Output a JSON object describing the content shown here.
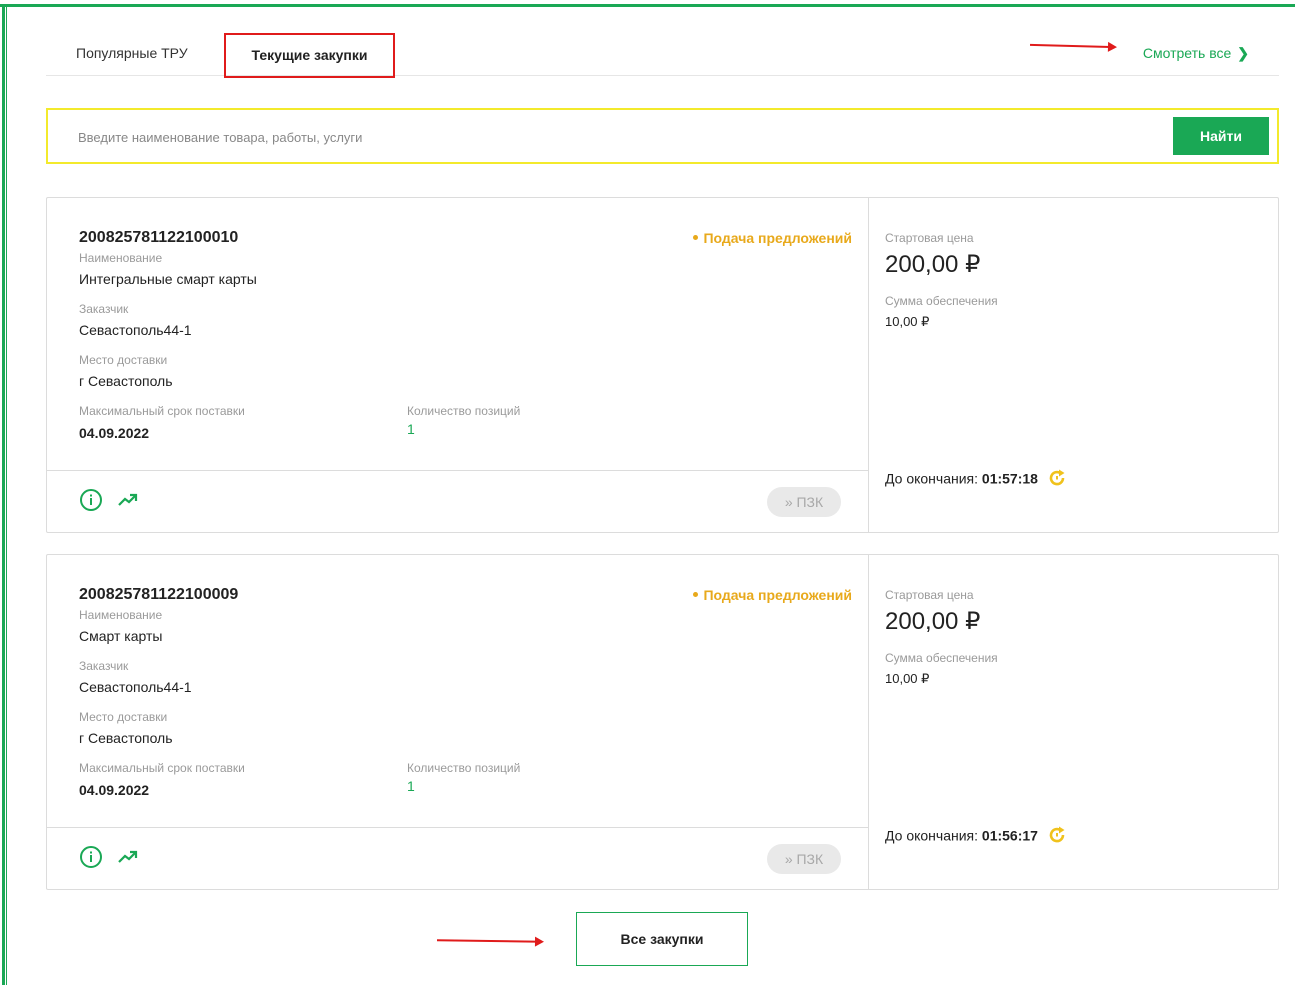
{
  "tabs": {
    "popular_label": "Популярные ТРУ",
    "current_label": "Текущие закупки",
    "see_all_label": "Смотреть все",
    "see_all_icon": "chevron-right-icon"
  },
  "search": {
    "placeholder": "Введите наименование товара, работы, услуги",
    "value": "",
    "button_label": "Найти"
  },
  "labels": {
    "name": "Наименование",
    "customer": "Заказчик",
    "delivery_place": "Место доставки",
    "max_delivery": "Максимальный срок поставки",
    "positions": "Количество позиций",
    "start_price": "Стартовая цена",
    "security_sum": "Сумма обеспечения",
    "until_end": "До окончания:",
    "pzk_button": "» ПЗК"
  },
  "purchases": [
    {
      "number": "200825781122100010",
      "status": "Подача предложений",
      "name": "Интегральные смарт карты",
      "customer": "Севастополь44-1",
      "delivery_place": "г Севастополь",
      "max_delivery": "04.09.2022",
      "positions": "1",
      "start_price": "200,00 ₽",
      "security_sum": "10,00 ₽",
      "time_left": "01:57:18"
    },
    {
      "number": "200825781122100009",
      "status": "Подача предложений",
      "name": "Смарт карты",
      "customer": "Севастополь44-1",
      "delivery_place": "г Севастополь",
      "max_delivery": "04.09.2022",
      "positions": "1",
      "start_price": "200,00 ₽",
      "security_sum": "10,00 ₽",
      "time_left": "01:56:17"
    }
  ],
  "footer": {
    "all_purchases_label": "Все закупки"
  },
  "colors": {
    "accent_green": "#1aa855",
    "status_orange": "#e8a91b",
    "highlight_red": "#e01b1b",
    "highlight_yellow": "#f3ea2c"
  }
}
